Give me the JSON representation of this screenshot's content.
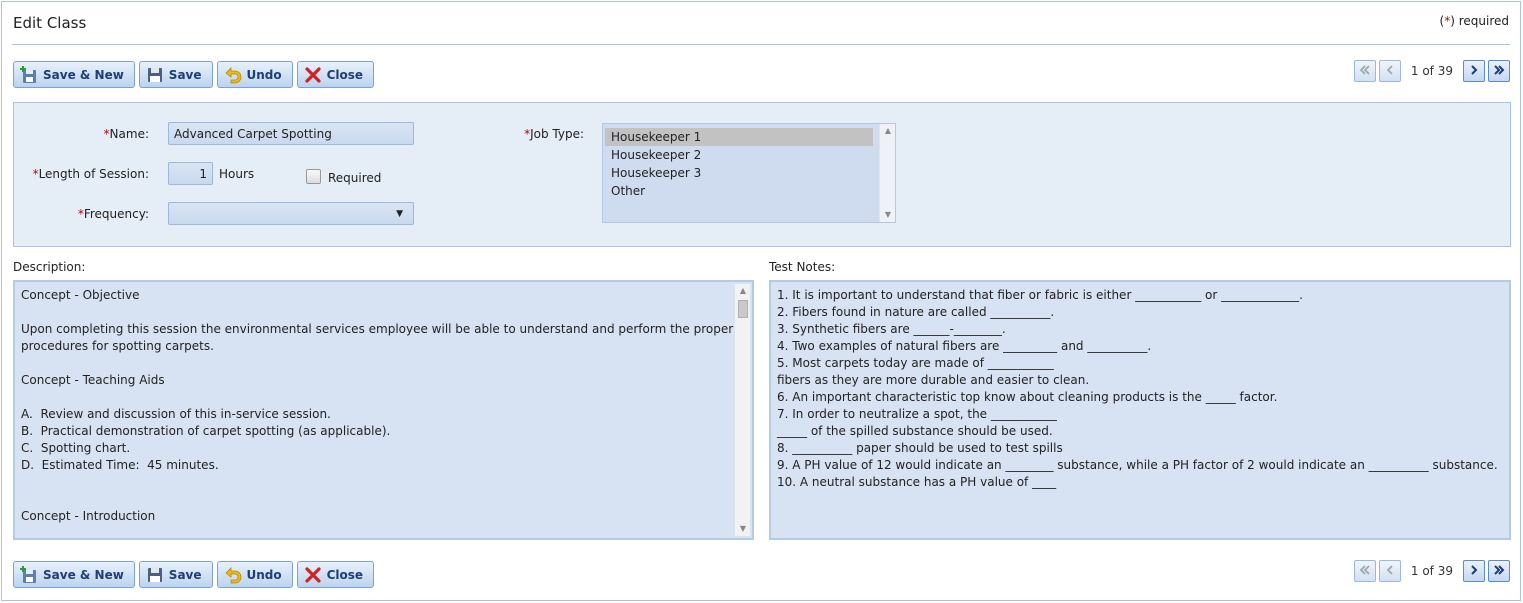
{
  "window": {
    "title": "Edit Class",
    "required_star": "*",
    "required_text": "required"
  },
  "toolbar": {
    "save_new_label": "Save & New",
    "save_label": "Save",
    "undo_label": "Undo",
    "close_label": "Close"
  },
  "pager": {
    "info": "1 of 39"
  },
  "form": {
    "name_label": "Name:",
    "name_value": "Advanced Carpet Spotting",
    "length_label": "Length of Session:",
    "length_value": "1",
    "length_unit": "Hours",
    "required_checkbox_label": "Required",
    "required_checked": false,
    "frequency_label": "Frequency:",
    "frequency_value": "",
    "job_type_label": "Job Type:",
    "job_types": [
      "Housekeeper 1",
      "Housekeeper 2",
      "Housekeeper 3",
      "Other"
    ],
    "job_type_selected": "Housekeeper 1"
  },
  "description": {
    "label": "Description:",
    "lines": [
      "Concept - Objective",
      "",
      "Upon completing this session the environmental services employee will be able to understand and perform the proper",
      "procedures for spotting carpets.",
      "",
      "Concept - Teaching Aids",
      "",
      "A.  Review and discussion of this in-service session.",
      "B.  Practical demonstration of carpet spotting (as applicable).",
      "C.  Spotting chart.",
      "D.  Estimated Time:  45 minutes.",
      "",
      "",
      "Concept - Introduction"
    ]
  },
  "test_notes": {
    "label": "Test Notes:",
    "lines": [
      "1. It is important to understand that fiber or fabric is either ___________ or _____________.",
      "2. Fibers found in nature are called __________.",
      "3. Synthetic fibers are ______-________.",
      "4. Two examples of natural fibers are _________ and __________.",
      "5. Most carpets today are made of ___________",
      "fibers as they are more durable and easier to clean.",
      "6. An important characteristic top know about cleaning products is the _____ factor.",
      "7. In order to neutralize a spot, the ___________",
      "_____ of the spilled substance should be used.",
      "8. __________ paper should be used to test spills",
      "9. A PH value of 12 would indicate an ________ substance, while a PH factor of 2 would indicate an __________ substance.",
      "10. A neutral substance has a PH value of ____"
    ]
  },
  "colors": {
    "accent": "#1e3f73",
    "panel_bg": "#e5edf7",
    "border": "#a9c4e3",
    "required_star": "#c00000"
  }
}
